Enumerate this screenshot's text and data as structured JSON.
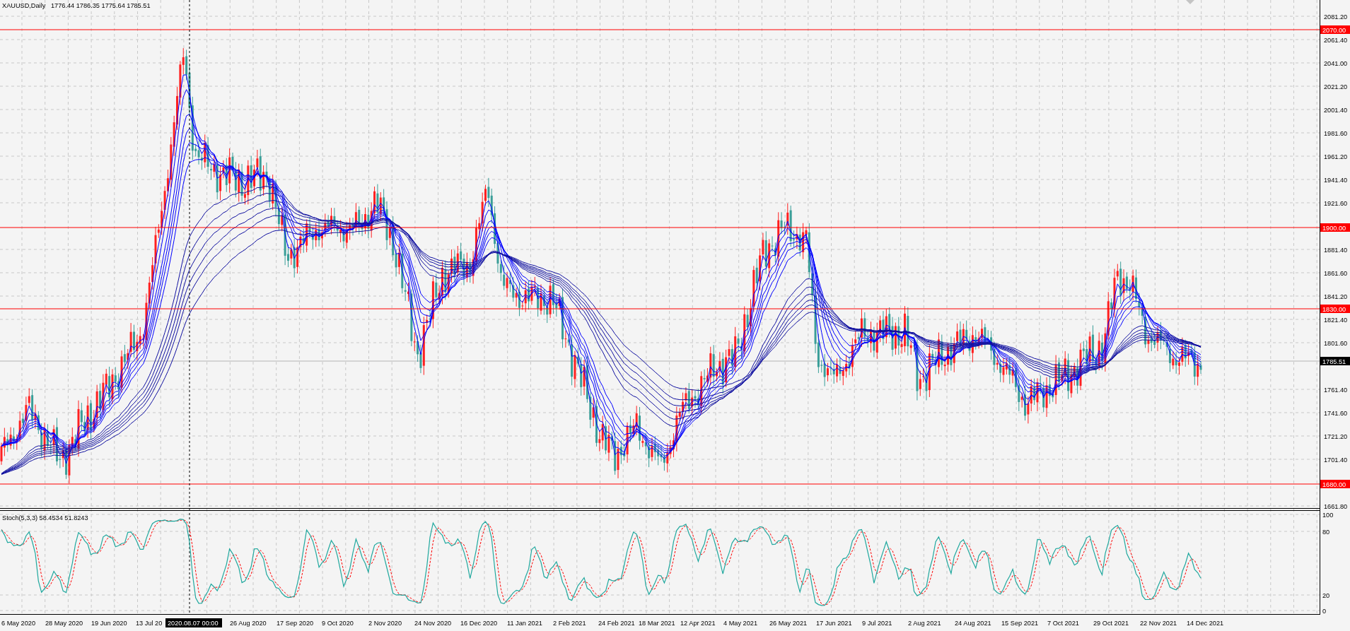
{
  "chart": {
    "symbol": "XAUUSD,Daily",
    "ohlc": "1776.44 1786.35 1775.64 1785.51",
    "price_axis": [
      "2081.20",
      "2061.40",
      "2041.00",
      "2021.20",
      "2001.40",
      "1981.60",
      "1961.20",
      "1941.40",
      "1921.60",
      "1881.40",
      "1861.60",
      "1841.20",
      "1821.40",
      "1801.60",
      "1761.40",
      "1741.60",
      "1721.20",
      "1701.40",
      "1661.80"
    ],
    "levels": [
      "2070.00",
      "1900.00",
      "1830.00",
      "1680.00"
    ],
    "current_price": "1785.51",
    "time_axis": [
      "6 May 2020",
      "28 May 2020",
      "19 Jun 2020",
      "13 Jul 20",
      "26 Aug 2020",
      "17 Sep 2020",
      "9 Oct 2020",
      "2 Nov 2020",
      "24 Nov 2020",
      "16 Dec 2020",
      "11 Jan 2021",
      "2 Feb 2021",
      "24 Feb 2021",
      "18 Mar 2021",
      "12 Apr 2021",
      "4 May 2021",
      "26 May 2021",
      "17 Jun 2021",
      "9 Jul 2021",
      "2 Aug 2021",
      "24 Aug 2021",
      "15 Sep 2021",
      "7 Oct 2021",
      "29 Oct 2021",
      "22 Nov 2021",
      "14 Dec 2021"
    ],
    "crosshair_time": "2020.08.07 00:00"
  },
  "stochastic": {
    "title": "Stoch(5,3,3) 58.4534 51.8243",
    "axis": [
      "100",
      "80",
      "20",
      "0"
    ]
  }
}
